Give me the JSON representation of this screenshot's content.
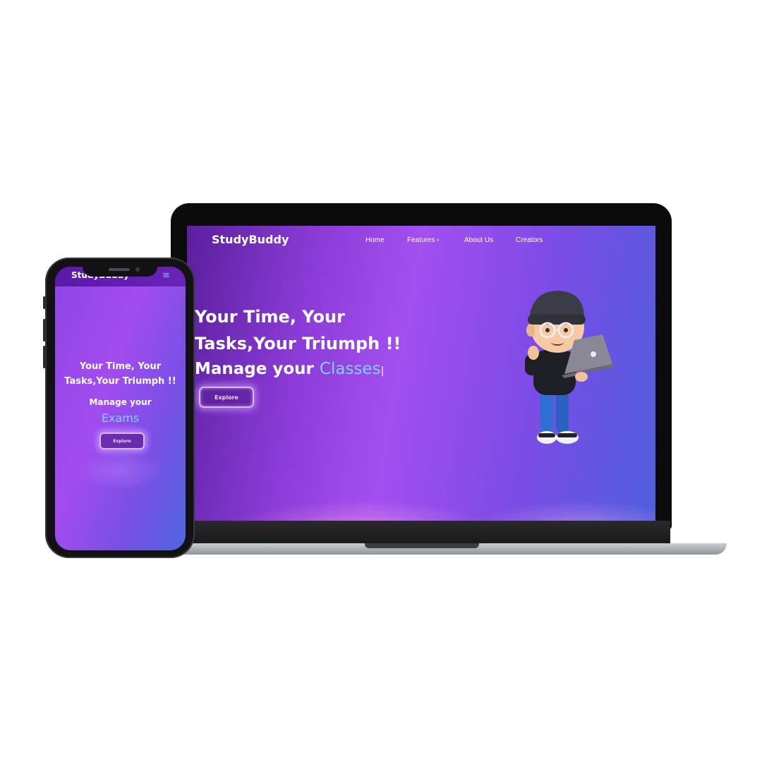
{
  "desktop": {
    "brand": "StudyBuddy",
    "nav": {
      "home": "Home",
      "features": "Features",
      "features_chevron": "˅",
      "about": "About Us",
      "creators": "Creators"
    },
    "hero": {
      "title_line1": "Your Time, Your",
      "title_line2": "Tasks,Your Triumph !!",
      "manage_prefix": "Manage your",
      "typed_word": "Classes",
      "caret": "|",
      "button": "Explore"
    }
  },
  "mobile": {
    "brand": "StudyBuddy",
    "menu_icon": "≡",
    "hero": {
      "title_line1": "Your Time, Your",
      "title_line2": "Tasks,Your Triumph !!",
      "manage_prefix": "Manage your",
      "typed_word": "Exams",
      "button": "Explore"
    }
  },
  "colors": {
    "accent_word": "#7fd0ff",
    "gradient_purple": "#a34ff0",
    "gradient_blue": "#4f5ee0",
    "button_glow": "#d9b6ff"
  },
  "icons": {
    "mascot": "boy-with-laptop-illustration",
    "menu": "hamburger-menu-icon"
  }
}
